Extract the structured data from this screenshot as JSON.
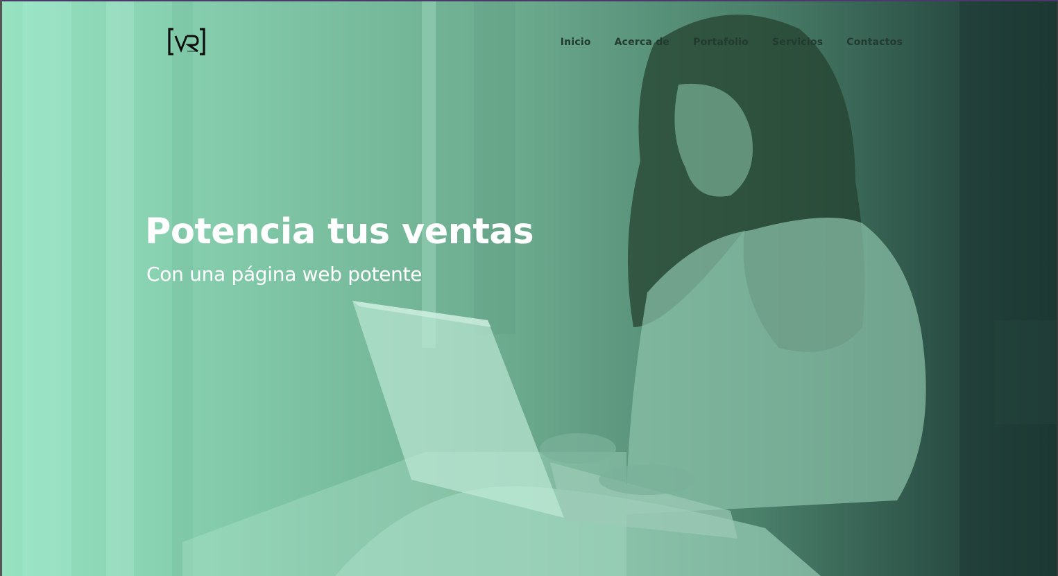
{
  "logo": {
    "text": "VR",
    "icon": "vr-bracket-logo"
  },
  "nav": {
    "items": [
      {
        "label": "Inicio"
      },
      {
        "label": "Acerca de"
      },
      {
        "label": "Portafolio"
      },
      {
        "label": "Servicios"
      },
      {
        "label": "Contactos"
      }
    ]
  },
  "hero": {
    "title": "Potencia tus ventas",
    "subtitle": "Con una página web potente",
    "image": "woman-with-laptop-photo"
  },
  "colors": {
    "overlay_light": "#96e2c1",
    "overlay_dark": "#1d3a33",
    "nav_text": "#233a30",
    "hero_text": "#ffffff"
  }
}
